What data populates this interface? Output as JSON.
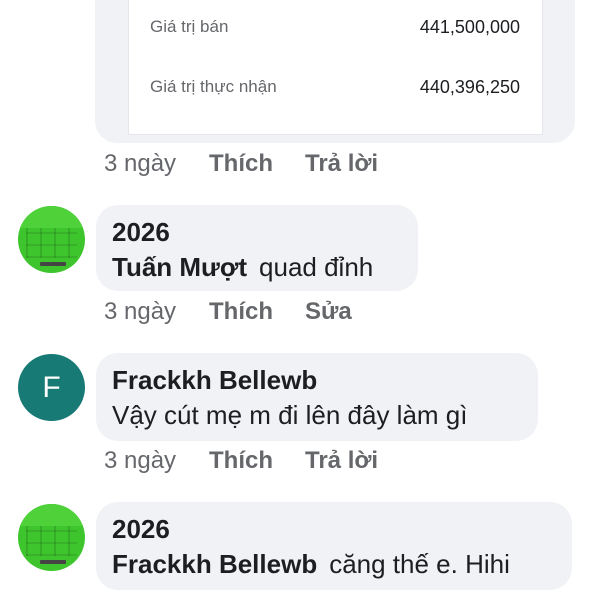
{
  "attachment": {
    "rows": [
      {
        "label": "Giá trị bán",
        "value": "441,500,000"
      },
      {
        "label": "Giá trị thực nhận",
        "value": "440,396,250"
      }
    ]
  },
  "comments": [
    {
      "avatar": {
        "type": "image",
        "icon": "green-grid-avatar",
        "color": "#3ec52e"
      },
      "author": "2026",
      "mention": "Tuấn Mượt",
      "text": "quad đỉnh",
      "time": "3 ngày",
      "actions": [
        "Thích",
        "Sửa"
      ]
    },
    {
      "avatar": {
        "type": "initial",
        "initial": "F",
        "color": "#177a75"
      },
      "author": "Frackkh Bellewb",
      "mention": "",
      "text": "Vậy cút mẹ m đi lên đây làm gì",
      "time": "3 ngày",
      "actions": [
        "Thích",
        "Trả lời"
      ]
    },
    {
      "avatar": {
        "type": "image",
        "icon": "green-grid-avatar",
        "color": "#3ec52e"
      },
      "author": "2026",
      "mention": "Frackkh Bellewb",
      "text": "căng thế e. Hihi",
      "time": "",
      "actions": []
    }
  ],
  "attachment_meta": {
    "time": "3 ngày",
    "actions": [
      "Thích",
      "Trả lời"
    ]
  }
}
